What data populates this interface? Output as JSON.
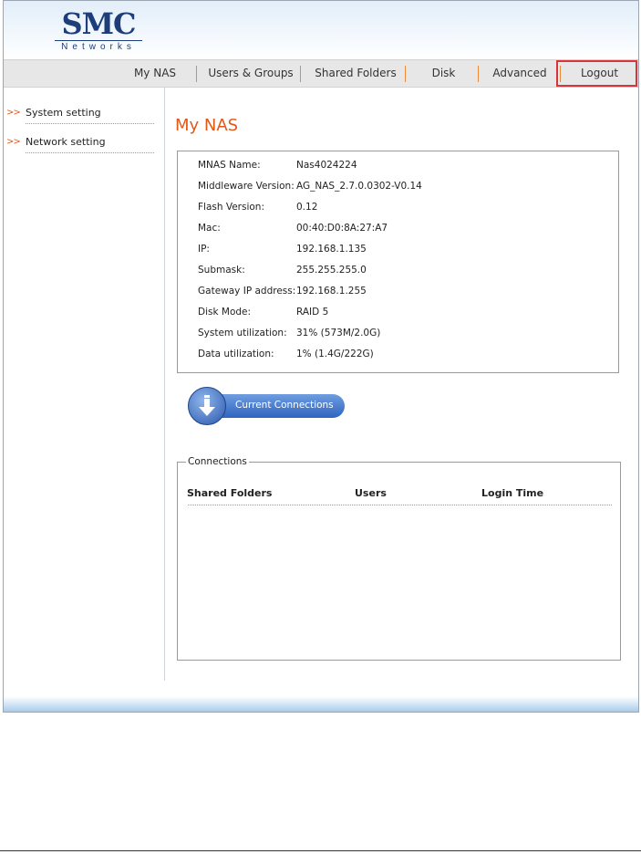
{
  "logo": {
    "brand": "SMC",
    "sub": "Networks"
  },
  "nav": {
    "items": [
      "My NAS",
      "Users & Groups",
      "Shared Folders",
      "Disk",
      "Advanced",
      "Logout"
    ]
  },
  "sidebar": {
    "arrow": ">>",
    "items": [
      "System setting",
      "Network setting"
    ]
  },
  "page": {
    "title": "My NAS"
  },
  "info": [
    {
      "label": "MNAS Name:",
      "value": "Nas4024224"
    },
    {
      "label": "Middleware Version:",
      "value": "AG_NAS_2.7.0.0302-V0.14"
    },
    {
      "label": "Flash Version:",
      "value": "0.12"
    },
    {
      "label": "Mac:",
      "value": "00:40:D0:8A:27:A7"
    },
    {
      "label": "IP:",
      "value": "192.168.1.135"
    },
    {
      "label": "Submask:",
      "value": "255.255.255.0"
    },
    {
      "label": "Gateway IP address:",
      "value": "192.168.1.255"
    },
    {
      "label": "Disk Mode:",
      "value": "RAID 5"
    },
    {
      "label": "System utilization:",
      "value": "31% (573M/2.0G)"
    },
    {
      "label": "Data utilization:",
      "value": "1% (1.4G/222G)"
    }
  ],
  "connections_button": {
    "label": "Current Connections",
    "icon": "download-arrow-icon"
  },
  "connections": {
    "legend": "Connections",
    "columns": [
      "Shared Folders",
      "Users",
      "Login Time"
    ]
  },
  "colors": {
    "accent": "#e25818",
    "nav_separator": "#e98a38",
    "logout_highlight": "#d9343c",
    "brand": "#1d3e7a"
  }
}
